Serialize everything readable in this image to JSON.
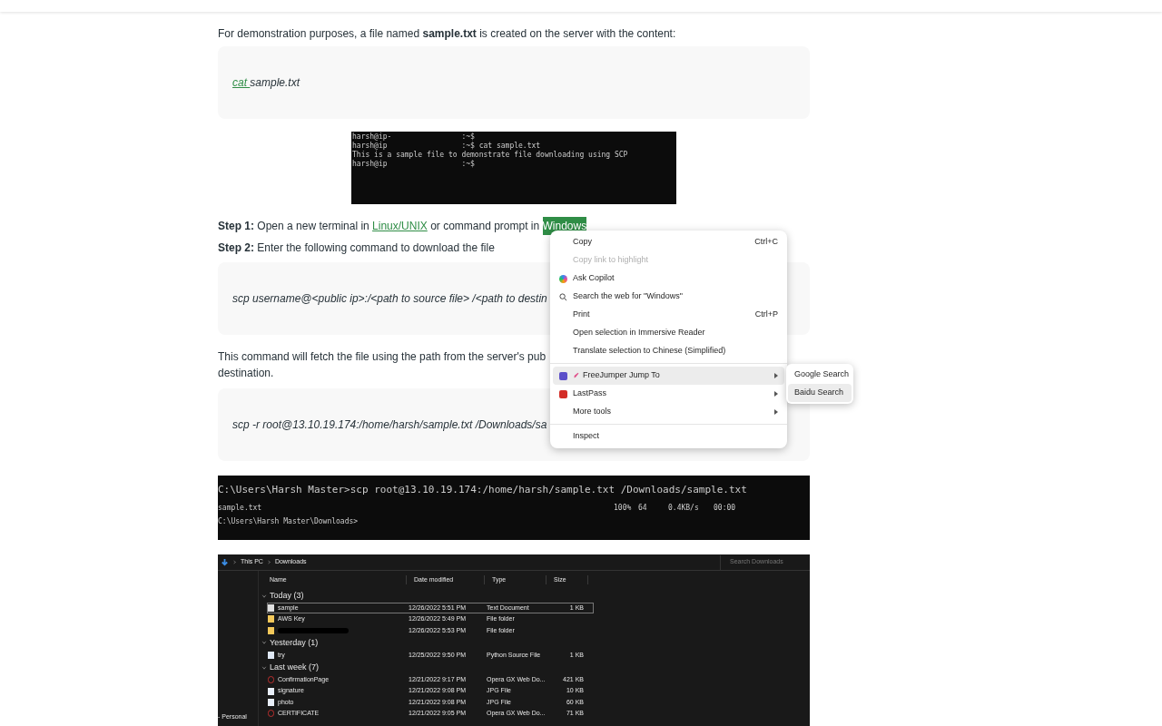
{
  "intro": "For demonstration purposes, a file named **sample.txt** is created on the server with the content:",
  "code_1": {
    "link": "cat ",
    "text": "sample.txt"
  },
  "terminal_1": [
    "harsh@ip-                :~$",
    "harsh@ip                 :~$ cat sample.txt",
    "This is a sample file to demonstrate file downloading using SCP",
    "harsh@ip                 :~$"
  ],
  "step_1": {
    "label": "Step 1:",
    "text": " Open a new terminal in ",
    "link": "Linux/UNIX",
    "text_2": " or command prompt in ",
    "highlight": "Windows"
  },
  "step_2": {
    "label": "Step 2:",
    "text": " Enter the following command to download the file"
  },
  "code_2": "scp username@<public ip>:/<path to source file> /<path to destin",
  "paragraph": [
    "This command will fetch the file using the path from the server's pub",
    "destination."
  ],
  "code_3": "scp -r root@13.10.19.174:/home/harsh/sample.txt /Downloads/sa",
  "terminal_2": [
    "C:\\Users\\Harsh Master>scp root@13.10.19.174:/home/harsh/sample.txt /Downloads/sample.txt",
    "sample.txt",
    "100%",
    "64",
    "0.4KB/s",
    "00:00",
    "C:\\Users\\Harsh Master\\Downloads>"
  ],
  "explorer": {
    "breadcrumb": [
      "This PC",
      "Downloads"
    ],
    "search_placeholder": "Search Downloads",
    "columns": [
      "Name",
      "Date modified",
      "Type",
      "Size"
    ],
    "sidebar_label": "- Personal",
    "groups": [
      {
        "title": "Today (3)",
        "files": [
          {
            "name": "sample",
            "date": "12/26/2022 5:51 PM",
            "type": "Text Document",
            "size": "1 KB",
            "kind": "text",
            "selected": true
          },
          {
            "name": "AWS Key",
            "date": "12/26/2022 5:49 PM",
            "type": "File folder",
            "kind": "folder",
            "selected": false
          },
          {
            "date": "12/26/2022 5:53 PM",
            "type": "File folder",
            "kind": "folder",
            "selected": false
          }
        ]
      },
      {
        "title": "Yesterday (1)",
        "files": [
          {
            "name": "try",
            "date": "12/25/2022 9:50 PM",
            "type": "Python Source File",
            "size": "1 KB",
            "kind": "python",
            "selected": false
          }
        ]
      },
      {
        "title": "Last week (7)",
        "files": [
          {
            "name": "ConfirmationPage",
            "date": "12/21/2022 9:17 PM",
            "type": "Opera GX Web Do...",
            "size": "421 KB",
            "kind": "web",
            "selected": false
          },
          {
            "name": "signature",
            "date": "12/21/2022 9:08 PM",
            "type": "JPG File",
            "size": "10 KB",
            "kind": "image",
            "selected": false
          },
          {
            "name": "photo",
            "date": "12/21/2022 9:08 PM",
            "type": "JPG File",
            "size": "60 KB",
            "kind": "image",
            "selected": false
          },
          {
            "name": "CERTIFICATE",
            "date": "12/21/2022 9:05 PM",
            "type": "Opera GX Web Do...",
            "size": "71 KB",
            "kind": "web",
            "selected": false
          }
        ]
      }
    ]
  },
  "context_menu": [
    {
      "kind": "item",
      "label": "Copy",
      "shortcut": "Ctrl+C",
      "disabled": false,
      "selected": false
    },
    {
      "kind": "item",
      "label": "Copy link to highlight",
      "disabled": true,
      "selected": false
    },
    {
      "kind": "item",
      "label": "Ask Copilot",
      "disabled": false,
      "selected": false
    },
    {
      "kind": "item",
      "label": "Search the web for \"Windows\"",
      "disabled": false,
      "selected": false
    },
    {
      "kind": "item",
      "label": "Print",
      "shortcut": "Ctrl+P",
      "disabled": false,
      "selected": false
    },
    {
      "kind": "item",
      "label": "Open selection in Immersive Reader",
      "disabled": false,
      "selected": false
    },
    {
      "kind": "item",
      "label": "Translate selection to Chinese (Simplified)",
      "disabled": false,
      "selected": false
    },
    {
      "kind": "separator"
    },
    {
      "kind": "item",
      "label": "FreeJumper Jump To",
      "submenu": true,
      "disabled": false,
      "selected": true
    },
    {
      "kind": "item",
      "label": "LastPass",
      "submenu": true,
      "disabled": false,
      "selected": false
    },
    {
      "kind": "item",
      "label": "More tools",
      "submenu": true,
      "disabled": false,
      "selected": false
    },
    {
      "kind": "separator"
    },
    {
      "kind": "item",
      "label": "Inspect",
      "disabled": false,
      "selected": false
    }
  ],
  "submenu": [
    {
      "label": "Google Search",
      "selected": false
    },
    {
      "label": "Baidu Search",
      "selected": true
    }
  ]
}
